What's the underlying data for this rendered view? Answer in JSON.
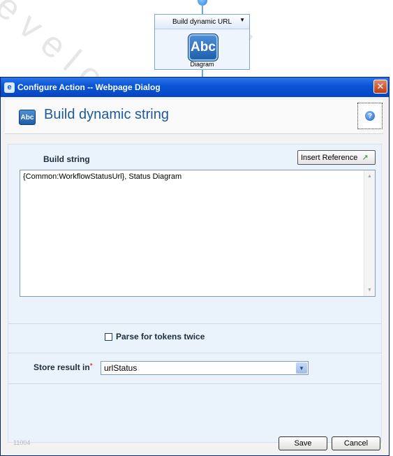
{
  "workflow_node": {
    "title": "Build dynamic URL",
    "icon_text": "Abc",
    "caption": "Diagram"
  },
  "dialog": {
    "window_title": "Configure Action -- Webpage Dialog",
    "close_glyph": "✕",
    "header_icon_text": "Abc",
    "header_title": "Build dynamic string",
    "help_glyph": "?",
    "build_string_label": "Build string",
    "insert_reference_label": "Insert Reference",
    "build_string_value": "{Common:WorkflowStatusUrl}, Status Diagram",
    "parse_tokens_label": "Parse for tokens twice",
    "parse_tokens_checked": false,
    "store_result_label": "Store result in",
    "required_marker": "*",
    "store_result_value": "urlStatus",
    "footer_code": "11004",
    "save_label": "Save",
    "cancel_label": "Cancel"
  },
  "icons": {
    "ie": "ie-icon",
    "close": "close-icon",
    "help": "help-icon",
    "insert_reference": "insert-reference-icon",
    "dropdown": "chevron-down-icon"
  },
  "colors": {
    "titlebar": "#0a56d8",
    "header_title": "#1c5a9a",
    "panel_bg": "#eaf2fb",
    "required": "#cc0000"
  }
}
